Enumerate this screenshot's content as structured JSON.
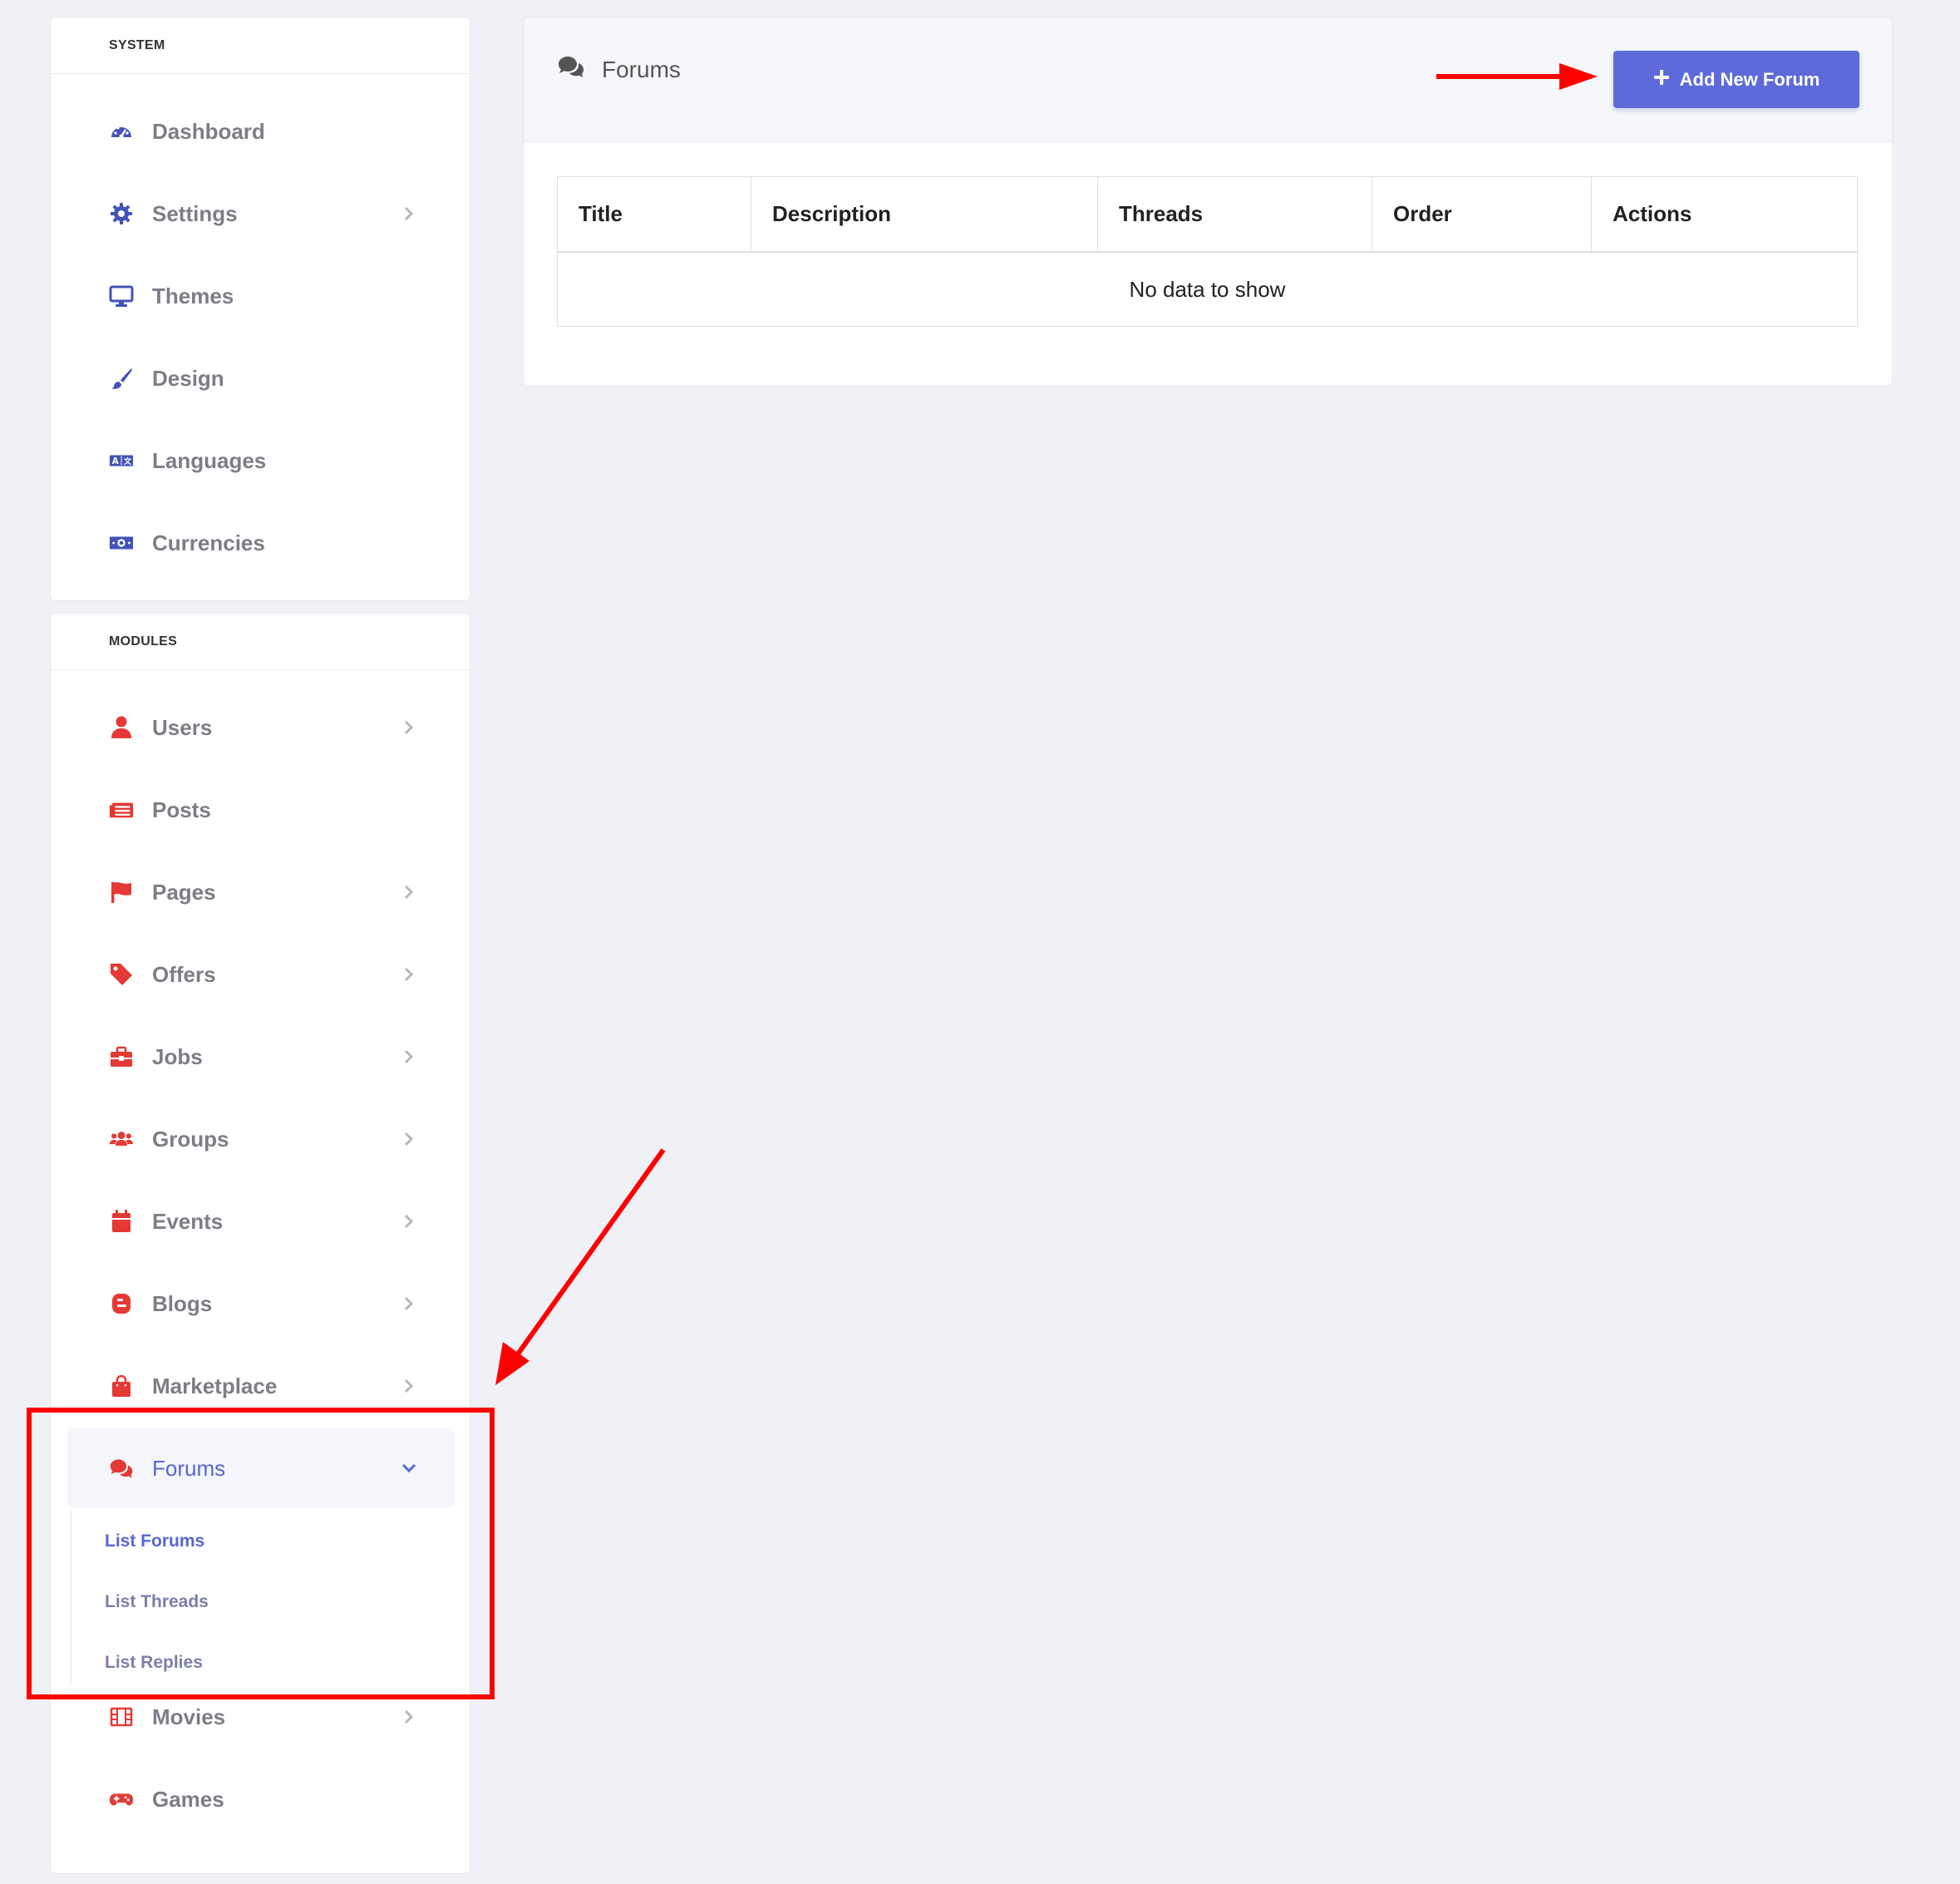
{
  "sidebar": {
    "system": {
      "heading": "SYSTEM",
      "items": [
        {
          "label": "Dashboard",
          "icon": "dashboard-gauge-icon"
        },
        {
          "label": "Settings",
          "icon": "gear-icon"
        },
        {
          "label": "Themes",
          "icon": "desktop-monitor-icon"
        },
        {
          "label": "Design",
          "icon": "paint-brush-icon"
        },
        {
          "label": "Languages",
          "icon": "language-icon"
        },
        {
          "label": "Currencies",
          "icon": "money-bill-icon"
        }
      ]
    },
    "modules": {
      "heading": "MODULES",
      "items": [
        {
          "label": "Users",
          "icon": "user-icon"
        },
        {
          "label": "Posts",
          "icon": "newspaper-icon"
        },
        {
          "label": "Pages",
          "icon": "flag-icon"
        },
        {
          "label": "Offers",
          "icon": "tag-icon"
        },
        {
          "label": "Jobs",
          "icon": "briefcase-icon"
        },
        {
          "label": "Groups",
          "icon": "users-group-icon"
        },
        {
          "label": "Events",
          "icon": "calendar-icon"
        },
        {
          "label": "Blogs",
          "icon": "blogger-icon"
        },
        {
          "label": "Marketplace",
          "icon": "shopping-bag-icon"
        },
        {
          "label": "Forums",
          "icon": "comments-icon"
        },
        {
          "label": "Movies",
          "icon": "film-icon"
        },
        {
          "label": "Games",
          "icon": "gamepad-icon"
        }
      ],
      "forums_submenu": [
        "List Forums",
        "List Threads",
        "List Replies"
      ]
    }
  },
  "main": {
    "title": "Forums",
    "title_icon": "comments-icon",
    "add_button": "Add New Forum",
    "table": {
      "columns": [
        "Title",
        "Description",
        "Threads",
        "Order",
        "Actions"
      ],
      "empty_message": "No data to show"
    }
  },
  "colors": {
    "system_icon": "#4452b8",
    "module_icon": "#e53935",
    "accent": "#5e6ad9",
    "annotation": "#ff0000"
  }
}
